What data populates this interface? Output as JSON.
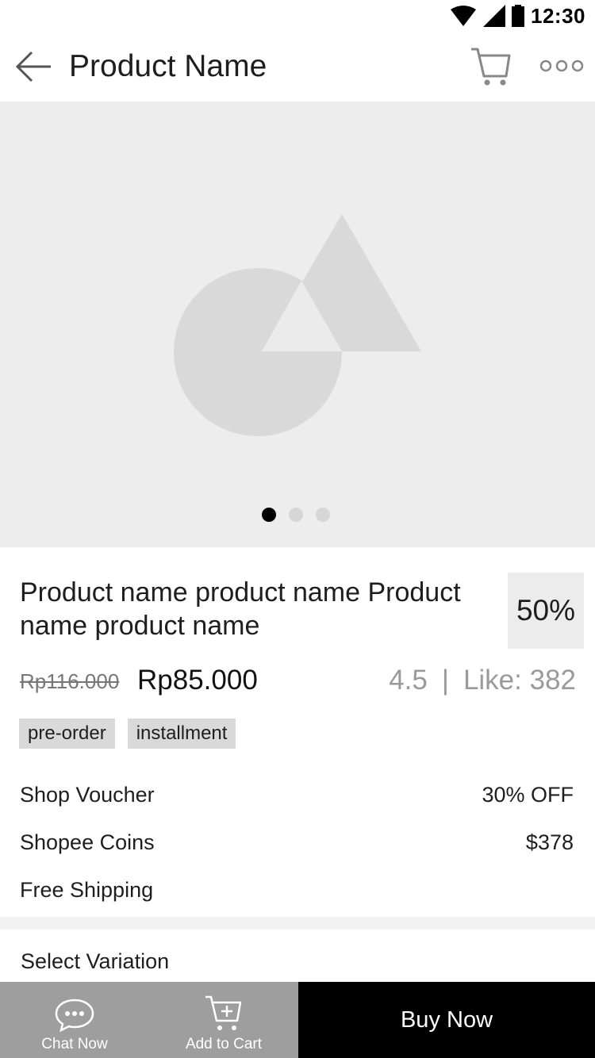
{
  "status_bar": {
    "time": "12:30"
  },
  "header": {
    "title": "Product Name"
  },
  "gallery": {
    "active_index": 0,
    "dot_count": 3
  },
  "product": {
    "title": "Product name product name Product name product name",
    "discount": "50%",
    "old_price": "Rp116.000",
    "new_price": "Rp85.000",
    "rating": "4.5",
    "separator": "|",
    "likes": "Like: 382",
    "tags": [
      "pre-order",
      "installment"
    ]
  },
  "info_rows": [
    {
      "label": "Shop Voucher",
      "value": "30% OFF"
    },
    {
      "label": "Shopee Coins",
      "value": "$378"
    },
    {
      "label": "Free Shipping",
      "value": ""
    }
  ],
  "variation": {
    "label": "Select Variation"
  },
  "bottom_bar": {
    "chat_label": "Chat Now",
    "add_cart_label": "Add to Cart",
    "buy_label": "Buy Now"
  },
  "icons": {
    "back": "arrow-left-icon",
    "cart": "cart-icon",
    "more": "more-dots-icon",
    "chat": "chat-bubble-icon",
    "add_cart": "cart-plus-icon"
  },
  "colors": {
    "bottom_left_bg": "#9e9e9e",
    "buy_now_bg": "#000000",
    "gallery_bg": "#ededed"
  }
}
